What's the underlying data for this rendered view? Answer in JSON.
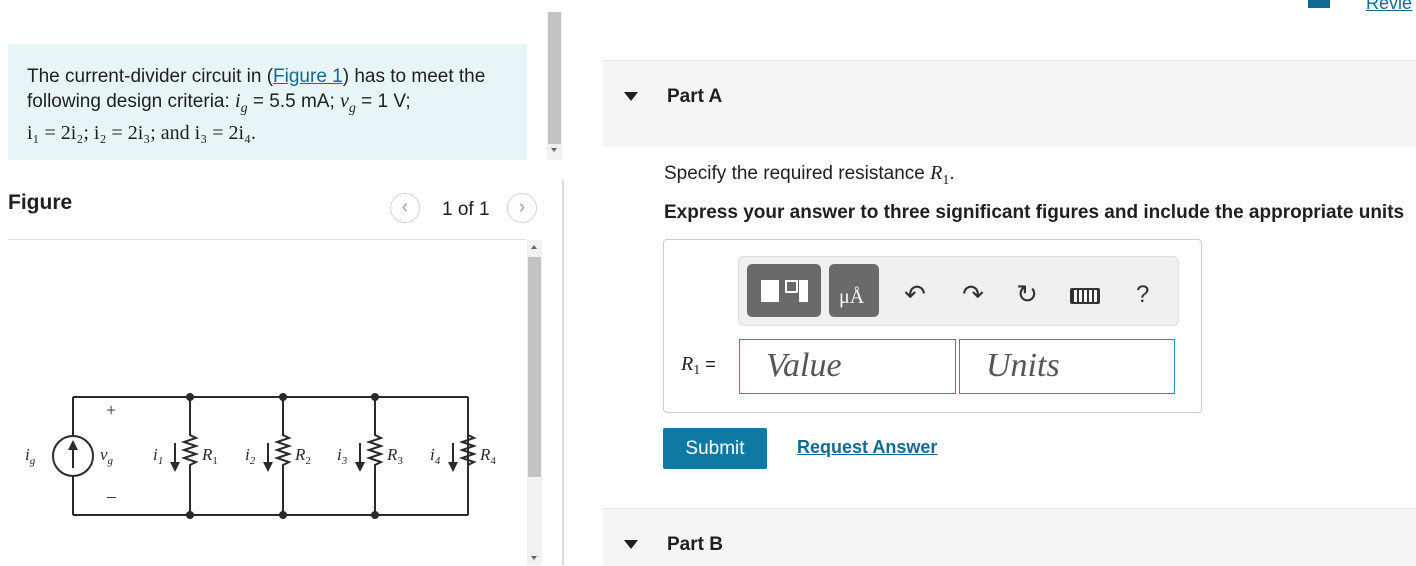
{
  "header": {
    "review_label": "Revie"
  },
  "problem": {
    "intro": "The current-divider circuit in (",
    "figure_link": "Figure 1",
    "intro_after": ") has to meet the",
    "line2_text": "following design criteria: ",
    "ig_sym": "i",
    "ig_sub": "g",
    "ig_val": " = 5.5 mA; ",
    "vg_sym": "v",
    "vg_sub": "g",
    "vg_val": " = 1 V;",
    "line3": "i₁ = 2i₂; i₂ = 2i₃; and i₃ = 2i₄."
  },
  "figure": {
    "title": "Figure",
    "pager": "1 of 1",
    "prev_icon": "chevron-left-icon",
    "next_icon": "chevron-right-icon",
    "circuit": {
      "source_label": "i",
      "source_sub": "g",
      "vg_label": "v",
      "vg_sub": "g",
      "plus": "+",
      "minus": "–",
      "branches": [
        {
          "current": "i",
          "current_sub": "1",
          "resistor": "R",
          "resistor_sub": "1"
        },
        {
          "current": "i",
          "current_sub": "2",
          "resistor": "R",
          "resistor_sub": "2"
        },
        {
          "current": "i",
          "current_sub": "3",
          "resistor": "R",
          "resistor_sub": "3"
        },
        {
          "current": "i",
          "current_sub": "4",
          "resistor": "R",
          "resistor_sub": "4"
        }
      ]
    }
  },
  "partA": {
    "title": "Part A",
    "prompt": "Specify the required resistance ",
    "prompt_sym": "R",
    "prompt_sub": "1",
    "prompt_end": ".",
    "instruction": "Express your answer to three significant figures and include the appropriate units",
    "toolbar": {
      "templates_icon": "templates-icon",
      "units_icon": "units-icon",
      "units_glyph": "μÅ",
      "undo_icon": "undo-icon",
      "redo_icon": "redo-icon",
      "reset_icon": "reset-icon",
      "keyboard_icon": "keyboard-icon",
      "help": "?"
    },
    "var_sym": "R",
    "var_sub": "1",
    "equals": " =",
    "value_placeholder": "Value",
    "units_placeholder": "Units",
    "submit": "Submit",
    "request_answer": "Request Answer"
  },
  "partB": {
    "title": "Part B"
  }
}
